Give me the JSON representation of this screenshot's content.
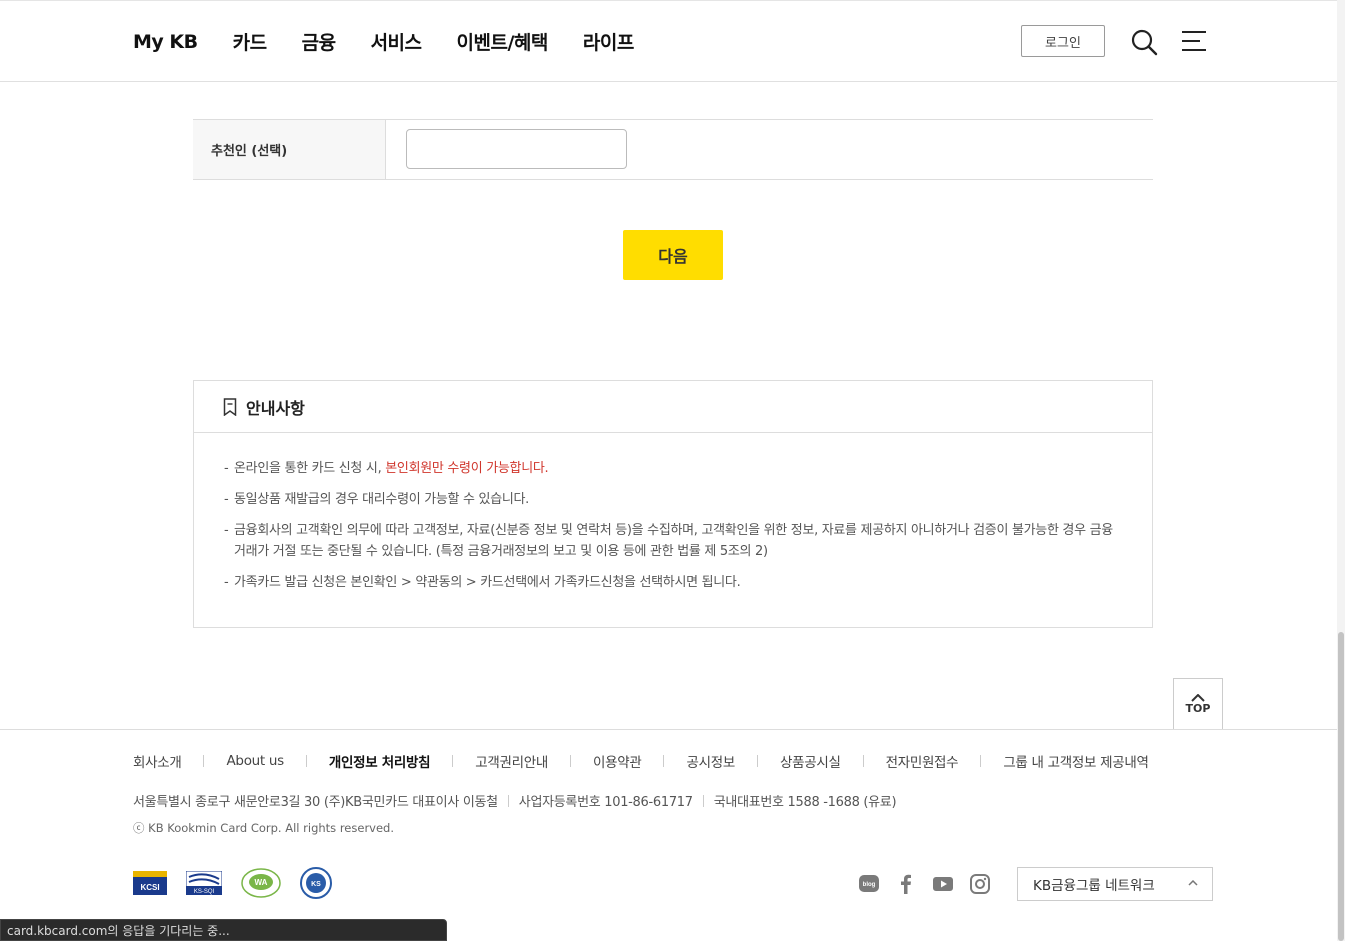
{
  "header": {
    "nav": [
      "My KB",
      "카드",
      "금융",
      "서비스",
      "이벤트/혜택",
      "라이프"
    ],
    "login_label": "로그인"
  },
  "form": {
    "recommender_label": "추천인 (선택)",
    "recommender_value": ""
  },
  "next_label": "다음",
  "notice": {
    "title": "안내사항",
    "items": [
      {
        "text": "온라인을 통한 카드 신청 시, ",
        "highlight": "본인회원만 수령이 가능합니다."
      },
      {
        "text": "동일상품 재발급의 경우 대리수령이 가능할 수 있습니다."
      },
      {
        "text": "금융회사의 고객확인 의무에 따라 고객정보, 자료(신분증 정보 및 연락처 등)을 수집하며, 고객확인을 위한 정보, 자료를 제공하지 아니하거나 검증이 불가능한 경우 금융거래가 거절 또는 중단될 수 있습니다. (특정 금융거래정보의 보고 및 이용 등에 관한 법률 제 5조의 2)"
      },
      {
        "text": "가족카드 발급 신청은 본인확인 > 약관동의 > 카드선택에서 가족카드신청을 선택하시면 됩니다."
      }
    ]
  },
  "top_label": "TOP",
  "footer": {
    "links": [
      "회사소개",
      "About us",
      "개인정보 처리방침",
      "고객권리안내",
      "이용약관",
      "공시정보",
      "상품공시실",
      "전자민원접수",
      "그룹 내 고객정보 제공내역"
    ],
    "bold_link": "개인정보 처리방침",
    "address": "서울특별시 종로구 새문안로3길 30 (주)KB국민카드 대표이사 이동철",
    "biz_no": "사업자등록번호 101-86-61717",
    "phone": "국내대표번호 1588 -1688 (유료)",
    "copyright": "ⓒ KB Kookmin Card Corp. All rights reserved.",
    "certs": [
      "KCSI",
      "KS-SQI",
      "WA",
      "KS"
    ],
    "sns": [
      "blog-icon",
      "facebook-icon",
      "youtube-icon",
      "instagram-icon"
    ],
    "network_label": "KB금융그룹 네트워크"
  },
  "status_text": "card.kbcard.com의 응답을 기다리는 중...",
  "colors": {
    "accent": "#ffdd00",
    "highlight": "#d0362c"
  }
}
